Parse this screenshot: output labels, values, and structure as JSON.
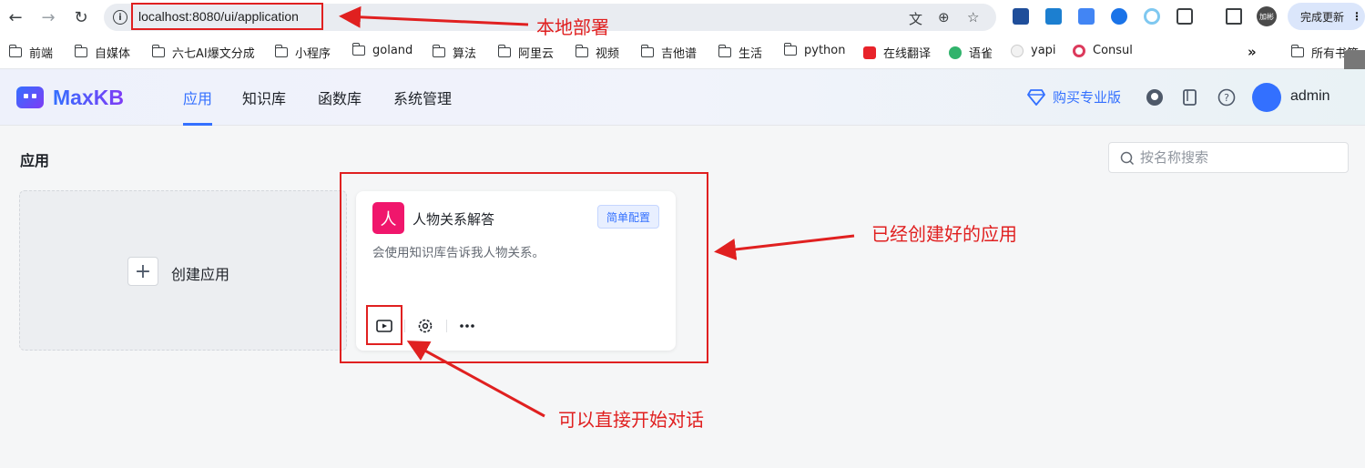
{
  "browser": {
    "url": "localhost:8080/ui/application",
    "update_button": "完成更新",
    "profile_initials": "加彬"
  },
  "bookmarks": {
    "items": [
      "前端",
      "自媒体",
      "六七AI爆文分成",
      "小程序",
      "goland",
      "算法",
      "阿里云",
      "视频",
      "吉他谱",
      "生活",
      "python",
      "在线翻译",
      "语雀",
      "yapi",
      "Consul"
    ],
    "overflow": "»",
    "all_bookmarks": "所有书签"
  },
  "app": {
    "logo": "MaxKB",
    "nav": [
      "应用",
      "知识库",
      "函数库",
      "系统管理"
    ],
    "pro_link": "购买专业版",
    "user": "admin"
  },
  "page": {
    "title": "应用",
    "search_placeholder": "按名称搜索",
    "create_label": "创建应用",
    "card": {
      "avatar_char": "人",
      "name": "人物关系解答",
      "tag": "简单配置",
      "description": "会使用知识库告诉我人物关系。"
    }
  },
  "annotations": {
    "local_deploy": "本地部署",
    "created_app": "已经创建好的应用",
    "start_chat": "可以直接开始对话"
  },
  "colors": {
    "accent": "#3370ff",
    "annotation_red": "#e02020",
    "app_avatar": "#f0166c"
  }
}
